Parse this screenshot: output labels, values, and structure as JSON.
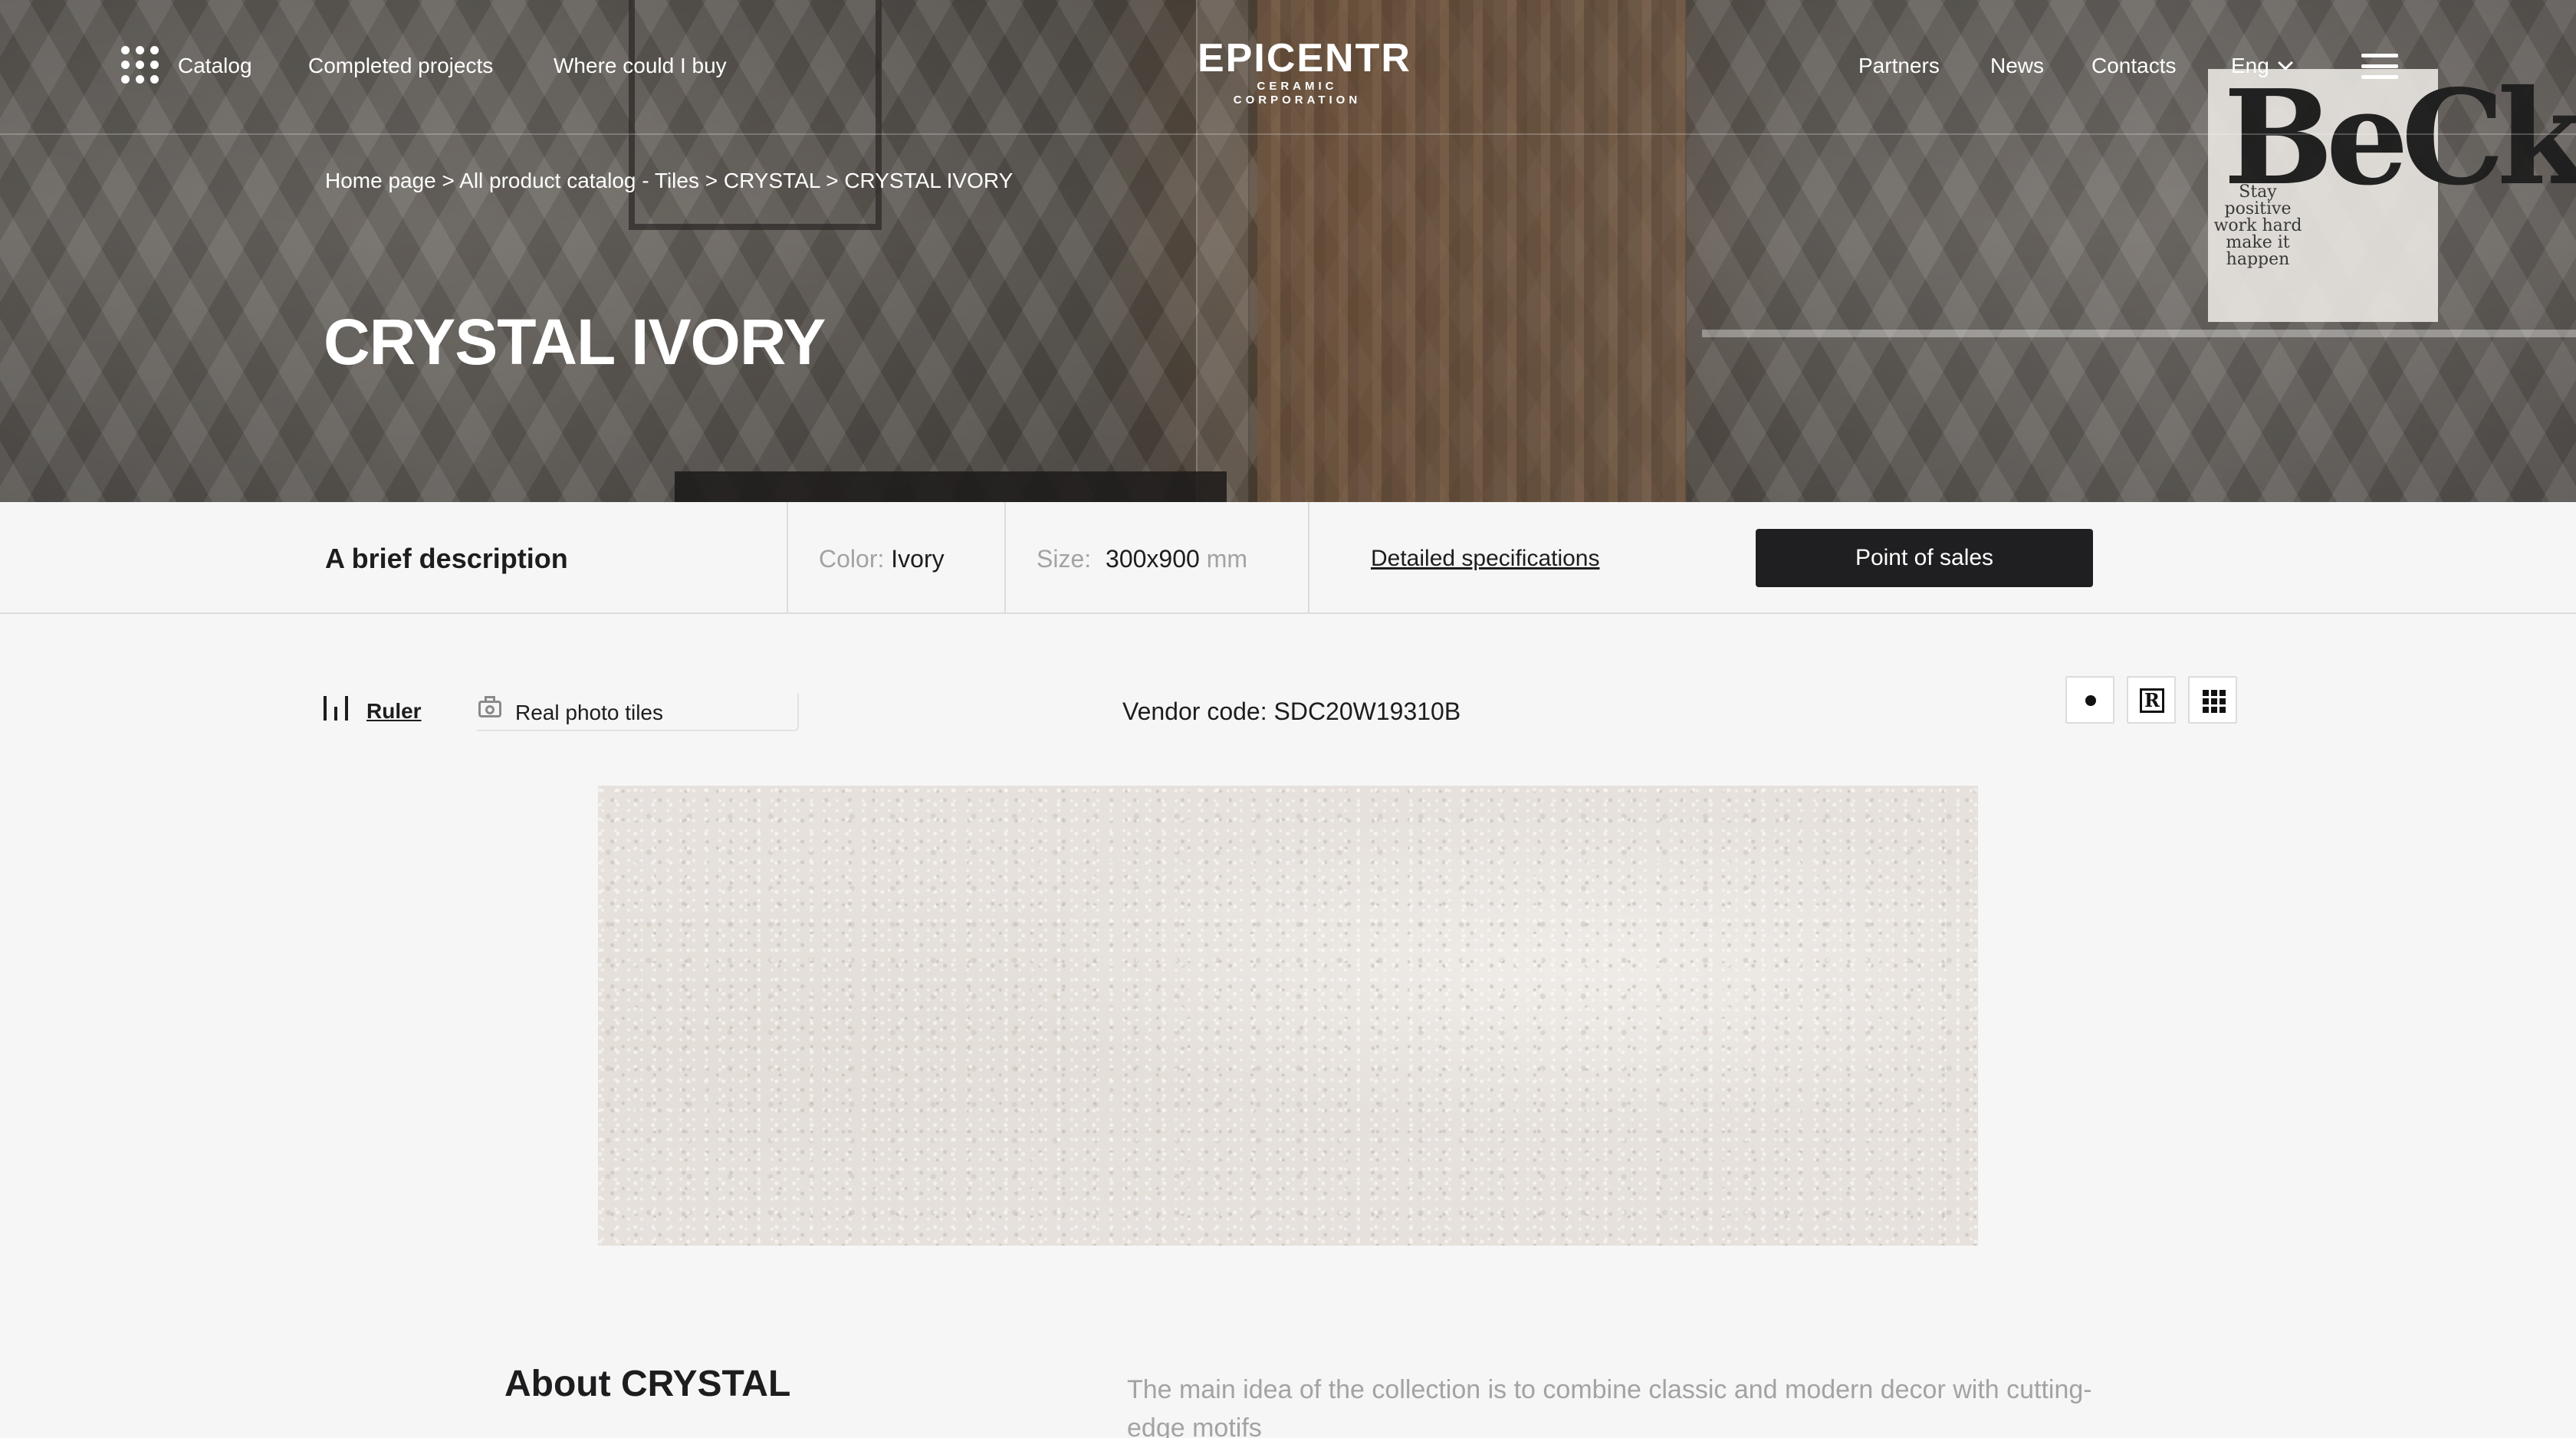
{
  "header": {
    "nav_left": [
      {
        "label": "Catalog",
        "icon": "grid-dots-icon"
      },
      {
        "label": "Completed projects"
      },
      {
        "label": "Where could I buy"
      }
    ],
    "logo": {
      "word": "EPICENTR",
      "tagline": "CERAMIC CORPORATION"
    },
    "nav_right": [
      {
        "label": "Partners"
      },
      {
        "label": "News"
      },
      {
        "label": "Contacts"
      }
    ],
    "language": {
      "label": "Eng",
      "icon": "chevron-down-icon"
    },
    "menu_icon": "hamburger-menu-icon"
  },
  "hero": {
    "poster_letters": "BeCk",
    "poster_text": "Stay positive work hard make it happen"
  },
  "breadcrumb": [
    "Home page",
    "All product catalog - Tiles",
    "CRYSTAL",
    "CRYSTAL IVORY"
  ],
  "breadcrumb_sep": ">",
  "page_title": "CRYSTAL IVORY",
  "info_bar": {
    "brief_label": "A brief description",
    "color_label": "Color:",
    "color_value": "Ivory",
    "size_label": "Size:",
    "size_value": "300x900",
    "size_unit": "mm",
    "specs_link": "Detailed specifications",
    "point_of_sales_button": "Point of sales"
  },
  "toolbar": {
    "ruler_label": "Ruler",
    "ruler_icon": "ruler-icon",
    "real_photo_label": "Real photo tiles",
    "real_photo_icon": "camera-icon",
    "vendor_code": "Vendor code: SDC20W19310B",
    "view_modes": [
      "single-dot-icon",
      "r-box-icon",
      "grid-icon"
    ],
    "view_r_letter": "R"
  },
  "tile_image": {
    "alt": "CRYSTAL IVORY tile"
  },
  "about": {
    "title": "About CRYSTAL",
    "text": "The main idea of the collection is to combine classic and modern decor with cutting-edge motifs"
  },
  "colors": {
    "accent_button": "#1f1f21",
    "muted_text": "#a3a3a3",
    "page_background": "#f6f6f6"
  }
}
